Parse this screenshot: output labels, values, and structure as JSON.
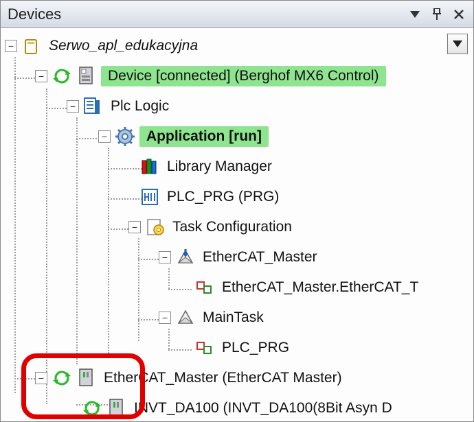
{
  "panel": {
    "title": "Devices"
  },
  "tree": {
    "root": {
      "label": "Serwo_apl_edukacyjna"
    },
    "device": {
      "label": "Device [connected] (Berghof MX6 Control)"
    },
    "plclogic": {
      "label": "Plc Logic"
    },
    "app": {
      "label": "Application [run]"
    },
    "libmgr": {
      "label": "Library Manager"
    },
    "plcprg": {
      "label": "PLC_PRG (PRG)"
    },
    "taskcfg": {
      "label": "Task Configuration"
    },
    "ecm_task": {
      "label": "EtherCAT_Master"
    },
    "ecm_sub": {
      "label": "EtherCAT_Master.EtherCAT_T"
    },
    "maintask": {
      "label": "MainTask"
    },
    "plcprg2": {
      "label": "PLC_PRG"
    },
    "ecm_dev": {
      "label": "EtherCAT_Master (EtherCAT Master)"
    },
    "invt": {
      "label": "INVT_DA100 (INVT_DA100(8Bit Asyn D"
    }
  }
}
